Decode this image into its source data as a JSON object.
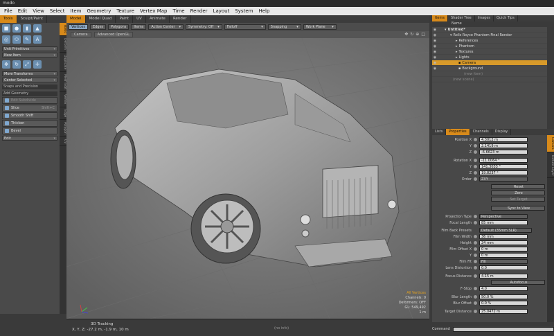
{
  "app": {
    "title": "modo"
  },
  "menu": [
    "File",
    "Edit",
    "View",
    "Select",
    "Item",
    "Geometry",
    "Texture",
    "Vertex Map",
    "Time",
    "Render",
    "Layout",
    "System",
    "Help"
  ],
  "left_tabs": [
    "Tools",
    "Sculpt/Paint"
  ],
  "toolbox": {
    "primitives": "Unit Primitives",
    "new_item": "New Item",
    "more_transforms": "More Transforms",
    "center_selected": "Center Selected",
    "snaps": "Snaps and Precision",
    "add_geometry": "Add Geometry",
    "buttons": [
      "Edit Subdivide",
      "Slice",
      "Smooth Shift",
      "Thicken",
      "Bevel"
    ],
    "slice_shortcut": "Shift+C",
    "edit": "Edit"
  },
  "left_vtabs": [
    "Basic",
    "Deform",
    "Duplicate",
    "Mesh Edit",
    "Vertex",
    "Edge",
    "Polygon",
    "UV"
  ],
  "vp_tabs": [
    "Model",
    "Model Quad",
    "Paint",
    "UV",
    "Animate",
    "Render"
  ],
  "vp_toolbar": {
    "vertices": "Vertices",
    "edges": "Edges",
    "polygons": "Polygons",
    "items": "Items",
    "action_center": "Action Center",
    "symmetry": "Symmetry: Off",
    "falloff": "Falloff",
    "snapping": "Snapping",
    "work_plane": "Work Plane"
  },
  "vp_header": {
    "view": "Camera",
    "shading": "Advanced OpenGL"
  },
  "vp_status": {
    "line1": "All Vertices",
    "line2": "Channels: 0",
    "line3": "Deformers: OFF",
    "line4": "GL: 549,492",
    "line5": "1 m"
  },
  "bottom": {
    "tool": "3D Tracking",
    "coords": "X, Y, Z:   -27.2 m, -1.9 m, 10 m",
    "info": "(no info)"
  },
  "right_tabs": [
    "Items",
    "Shader Tree",
    "Images",
    "Quick Tips"
  ],
  "tree": {
    "header": "Name",
    "rows": [
      {
        "label": "Untitled*",
        "indent": 0
      },
      {
        "label": "Rolls Royce Phantom Final Render",
        "indent": 1
      },
      {
        "label": "References",
        "indent": 2
      },
      {
        "label": "Phantom",
        "indent": 2
      },
      {
        "label": "Textures",
        "indent": 2
      },
      {
        "label": "Lights",
        "indent": 2
      },
      {
        "label": "Camera",
        "indent": 2,
        "selected": true
      },
      {
        "label": "Background",
        "indent": 2
      },
      {
        "label": "(new item)",
        "indent": 2,
        "dim": true
      },
      {
        "label": "(new scene)",
        "indent": 0,
        "dim": true
      }
    ]
  },
  "prop_tabs": [
    "Lists",
    "Properties",
    "Channels",
    "Display"
  ],
  "prop_vtabs": [
    "Camera",
    "Texture Layer"
  ],
  "props": {
    "pos_x_label": "Position X",
    "pos_x": "4.3012 m",
    "pos_y_label": "Y",
    "pos_y": "2.1419 m",
    "pos_z_label": "Z",
    "pos_z": "-6.6623 m",
    "rot_x_label": "Rotation X",
    "rot_x": "-11.0064 °",
    "rot_y_label": "Y",
    "rot_y": "141.3033 °",
    "rot_z_label": "Z",
    "rot_z": "19.8237 °",
    "order_label": "Order",
    "order": "ZXY",
    "reset": "Reset",
    "zero": "Zero",
    "add_target": "Set Target",
    "sync": "Sync to View",
    "projection_label": "Projection Type",
    "projection": "Perspective",
    "focal_label": "Focal Length",
    "focal": "85 mm",
    "filmback_label": "Film Back Presets",
    "filmback": "Default (35mm SLR)",
    "filmw_label": "Film Width",
    "filmw": "36 mm",
    "height_label": "Height",
    "height": "24 mm",
    "offx_label": "Film Offset X",
    "offx": "0 m",
    "offy_label": "Y",
    "offy": "0 m",
    "fit_label": "Film Fit",
    "fit": "Fill",
    "lens_label": "Lens Distortion",
    "lens": "0.0",
    "focus_label": "Focus Distance",
    "focus": "4.15 m",
    "autofocus": "Autofocus",
    "fstop_label": "F-Stop",
    "fstop": "4.0",
    "blurlen_label": "Blur Length",
    "blurlen": "50.0 %",
    "bluroff_label": "Blur Offset",
    "bluroff": "0.0 %",
    "target_label": "Target Distance",
    "target": "25.0472 m"
  },
  "command_label": "Command"
}
